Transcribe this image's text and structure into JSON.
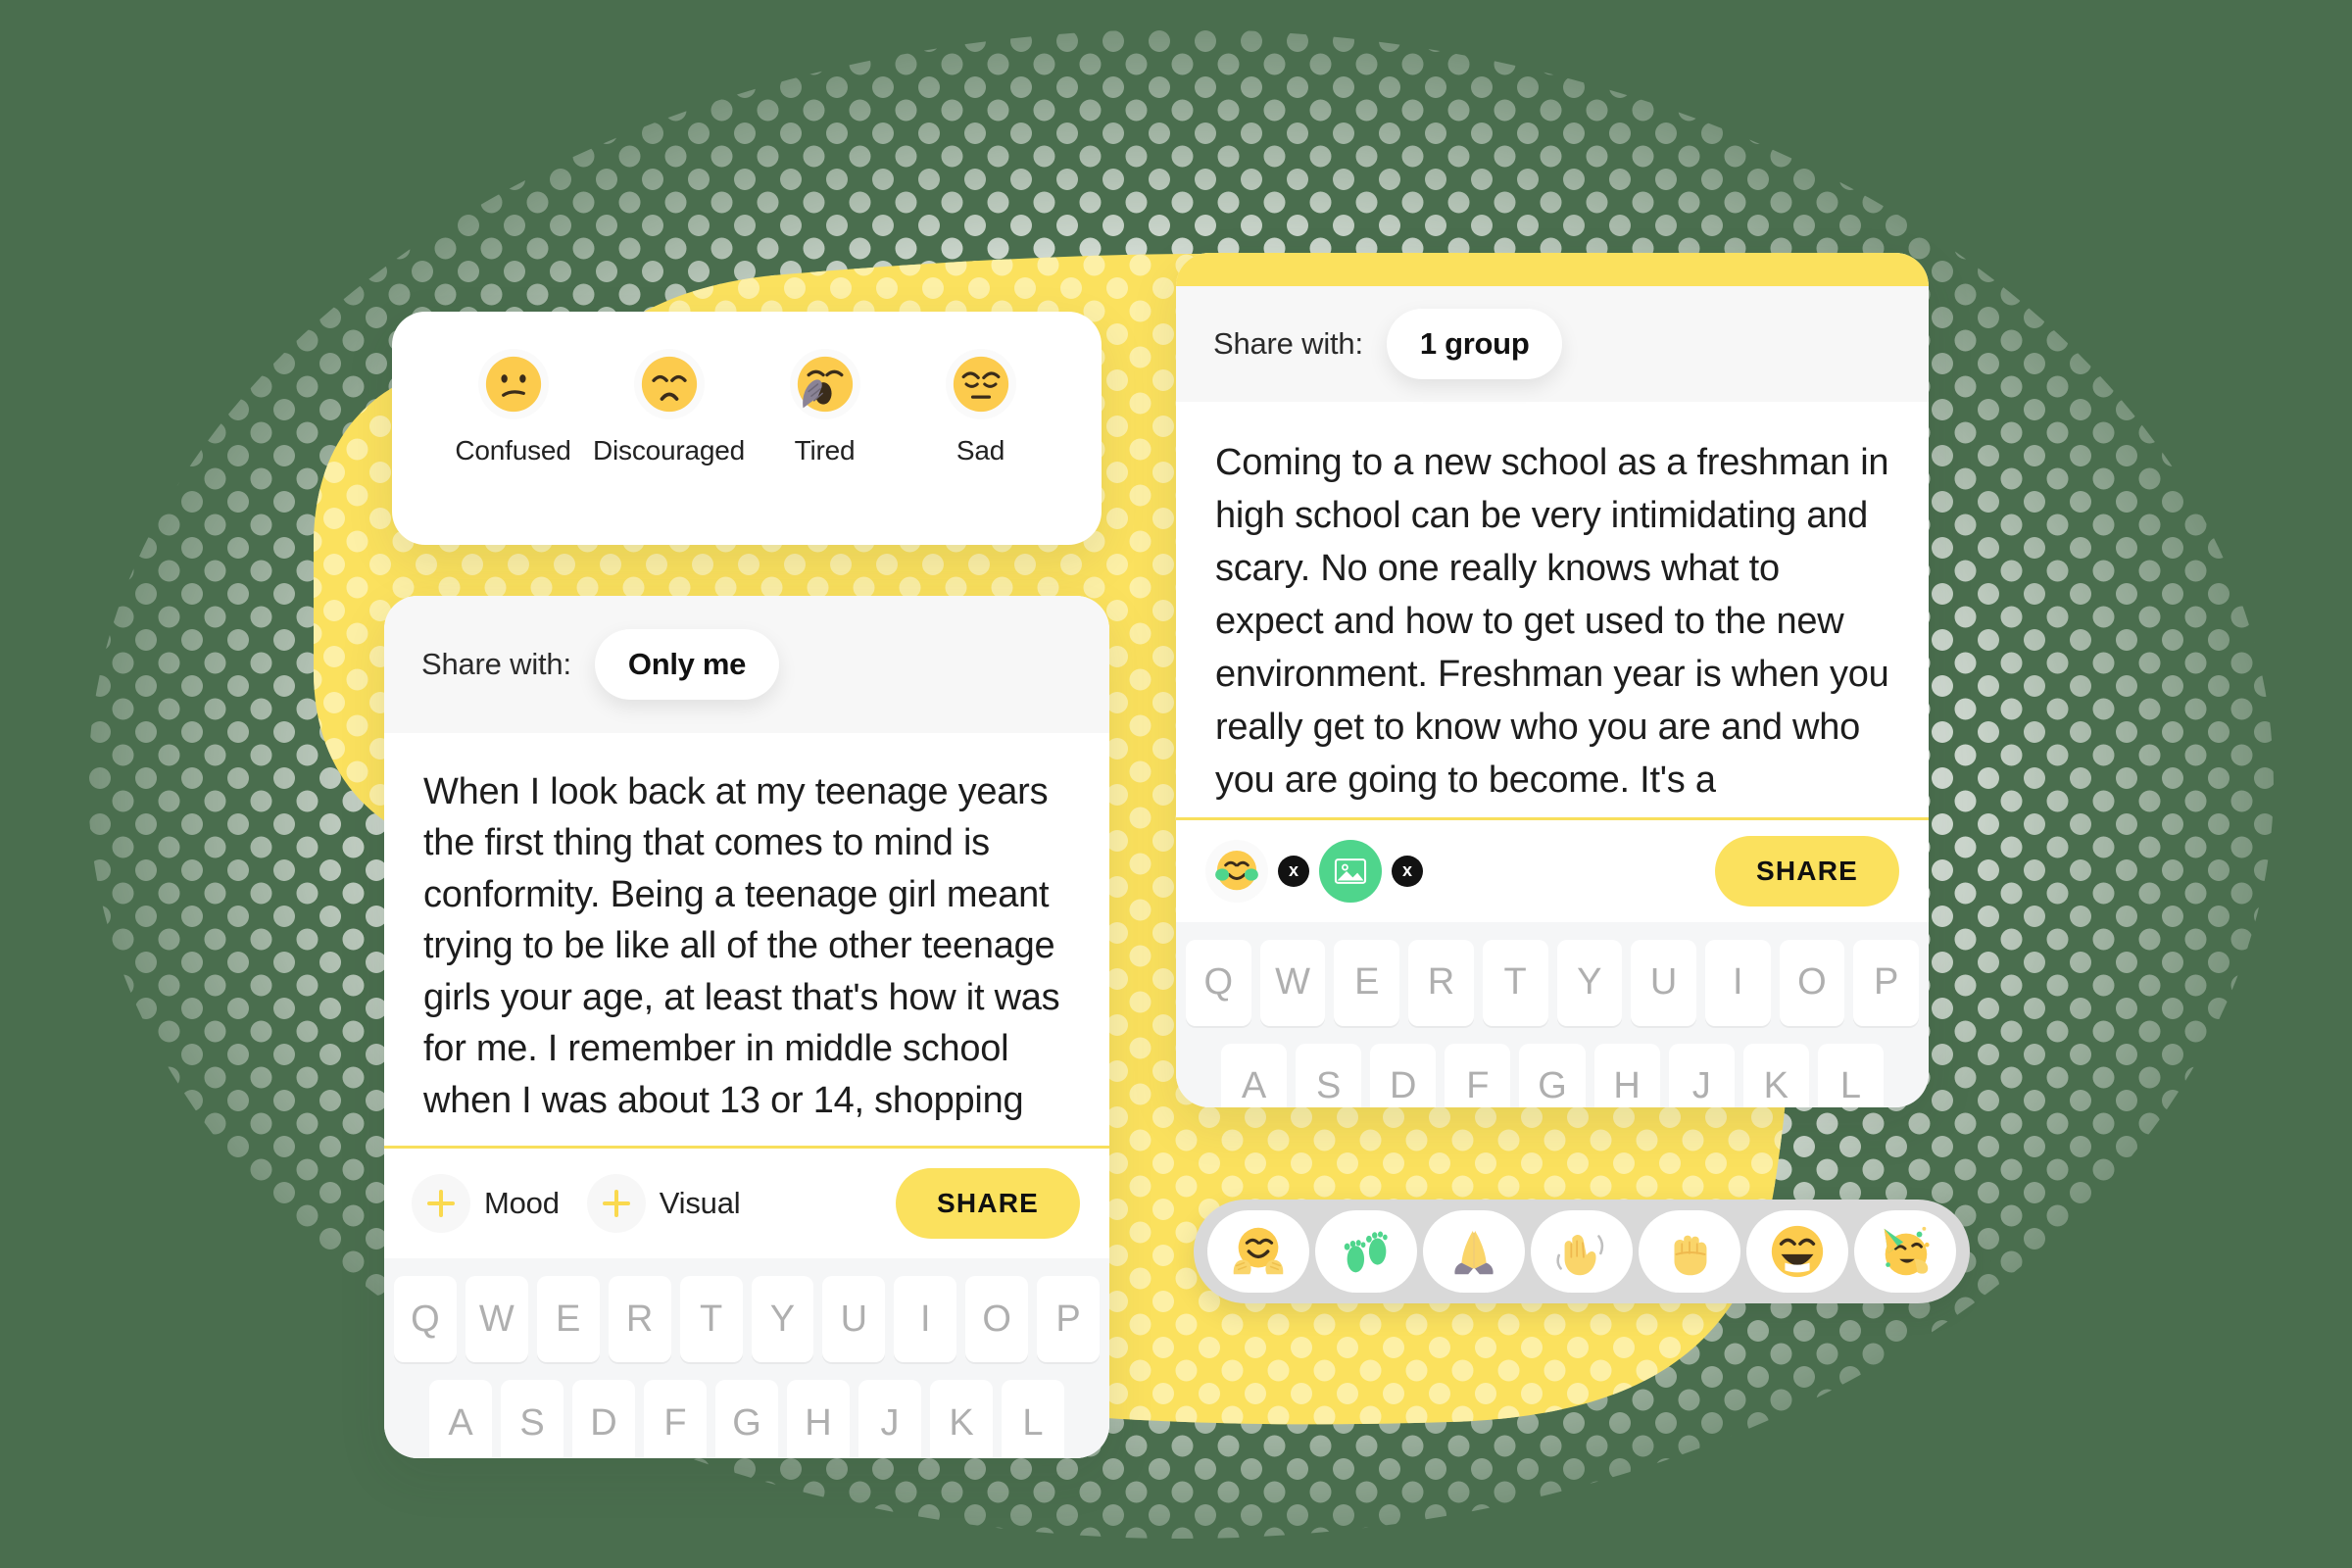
{
  "colors": {
    "background_green": "#4A6E4E",
    "blob_yellow": "#FBE15E",
    "accent_yellow": "#FAD94E",
    "share_button_yellow": "#FBE15E",
    "image_chip_green": "#4FD58C",
    "card_white": "#FFFFFF",
    "header_gray": "#F7F7F7",
    "keyboard_gray": "#F5F6F7",
    "emoji_bar_gray": "#D9D9D9",
    "key_label_gray": "#AFAFAF",
    "divider_yellow": "#F8DF5C"
  },
  "mood_card": {
    "moods": [
      {
        "label": "Confused",
        "icon": "confused-face-emoji"
      },
      {
        "label": "Discouraged",
        "icon": "frowning-face-emoji"
      },
      {
        "label": "Tired",
        "icon": "yawning-face-emoji"
      },
      {
        "label": "Sad",
        "icon": "pensive-face-emoji"
      }
    ]
  },
  "compose_left": {
    "share_label": "Share with:",
    "share_value": "Only me",
    "body": "When I look back at my teenage years the first thing that comes to mind is conformity. Being a teenage girl meant trying to be like all of the other teenage girls your age, at least that's how it was for me. I remember in middle school when I was about 13 or 14, shopping",
    "tools": [
      {
        "label": "Mood",
        "icon": "plus-icon"
      },
      {
        "label": "Visual",
        "icon": "plus-icon"
      }
    ],
    "share_button": "SHARE",
    "keyboard": {
      "row1": [
        "Q",
        "W",
        "E",
        "R",
        "T",
        "Y",
        "U",
        "I",
        "O",
        "P"
      ],
      "row2": [
        "A",
        "S",
        "D",
        "F",
        "G",
        "H",
        "J",
        "K",
        "L"
      ]
    }
  },
  "compose_right": {
    "share_label": "Share with:",
    "share_value": "1 group",
    "body": "Coming to a new school as a freshman in high school can be very intimidating and scary. No one really knows what to expect and how to get used to the new environment. Freshman year is when you really get to know who you are and who you are going to become. It's a",
    "attachments": [
      {
        "type": "emoji",
        "icon": "hugging-face-emoji",
        "remove_label": "x"
      },
      {
        "type": "image",
        "icon": "photo-icon",
        "remove_label": "x"
      }
    ],
    "share_button": "SHARE",
    "keyboard": {
      "row1": [
        "Q",
        "W",
        "E",
        "R",
        "T",
        "Y",
        "U",
        "I",
        "O",
        "P"
      ],
      "row2": [
        "A",
        "S",
        "D",
        "F",
        "G",
        "H",
        "J",
        "K",
        "L"
      ]
    }
  },
  "emoji_picker": {
    "emojis": [
      {
        "icon": "hugging-face-emoji"
      },
      {
        "icon": "footprints-emoji"
      },
      {
        "icon": "folded-hands-emoji"
      },
      {
        "icon": "waving-hand-emoji"
      },
      {
        "icon": "raised-fist-emoji"
      },
      {
        "icon": "grinning-squinting-face-emoji"
      },
      {
        "icon": "partying-face-emoji"
      }
    ]
  }
}
